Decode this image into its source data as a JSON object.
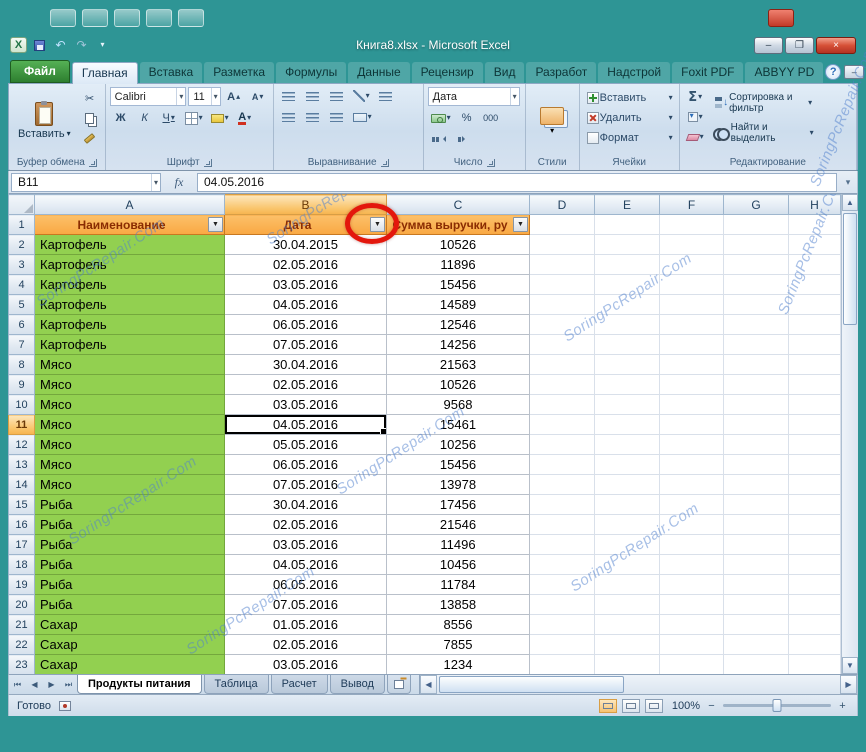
{
  "window": {
    "title": "Книга8.xlsx - Microsoft Excel"
  },
  "ribbon": {
    "tabs": [
      {
        "label": "Файл",
        "type": "file"
      },
      {
        "label": "Главная",
        "type": "active"
      },
      {
        "label": "Вставка",
        "type": "normal"
      },
      {
        "label": "Разметка",
        "type": "normal"
      },
      {
        "label": "Формулы",
        "type": "normal"
      },
      {
        "label": "Данные",
        "type": "normal"
      },
      {
        "label": "Рецензир",
        "type": "normal"
      },
      {
        "label": "Вид",
        "type": "normal"
      },
      {
        "label": "Разработ",
        "type": "normal"
      },
      {
        "label": "Надстрой",
        "type": "normal"
      },
      {
        "label": "Foxit PDF",
        "type": "normal"
      },
      {
        "label": "ABBYY PD",
        "type": "normal"
      }
    ],
    "clipboard": {
      "label": "Буфер обмена",
      "paste": "Вставить"
    },
    "font": {
      "label": "Шрифт",
      "name": "Calibri",
      "size": "11",
      "bold": "Ж",
      "italic": "К",
      "underline": "Ч"
    },
    "alignment": {
      "label": "Выравнивание"
    },
    "number": {
      "label": "Число",
      "format": "Дата",
      "percent": "%",
      "thousands": "000"
    },
    "styles": {
      "label": "Стили"
    },
    "cells": {
      "label": "Ячейки",
      "insert": "Вставить",
      "remove": "Удалить",
      "format": "Формат"
    },
    "editing": {
      "label": "Редактирование",
      "autosum": "Σ",
      "sort": "Сортировка и фильтр",
      "find": "Найти и выделить"
    }
  },
  "formula_bar": {
    "name_box": "B11",
    "fx": "fx",
    "value": "04.05.2016"
  },
  "grid": {
    "columns": [
      "A",
      "B",
      "C",
      "D",
      "E",
      "F",
      "G",
      "H"
    ],
    "selected_column": "B",
    "selected_row": 11,
    "header_row_number": "1",
    "headers": {
      "name": "Наименование",
      "date": "Дата",
      "sum": "Сумма выручки, ру"
    },
    "rows": [
      {
        "n": 2,
        "name": "Картофель",
        "date": "30.04.2015",
        "sum": "10526"
      },
      {
        "n": 3,
        "name": "Картофель",
        "date": "02.05.2016",
        "sum": "11896"
      },
      {
        "n": 4,
        "name": "Картофель",
        "date": "03.05.2016",
        "sum": "15456"
      },
      {
        "n": 5,
        "name": "Картофель",
        "date": "04.05.2016",
        "sum": "14589"
      },
      {
        "n": 6,
        "name": "Картофель",
        "date": "06.05.2016",
        "sum": "12546"
      },
      {
        "n": 7,
        "name": "Картофель",
        "date": "07.05.2016",
        "sum": "14256"
      },
      {
        "n": 8,
        "name": "Мясо",
        "date": "30.04.2016",
        "sum": "21563"
      },
      {
        "n": 9,
        "name": "Мясо",
        "date": "02.05.2016",
        "sum": "10526"
      },
      {
        "n": 10,
        "name": "Мясо",
        "date": "03.05.2016",
        "sum": "9568"
      },
      {
        "n": 11,
        "name": "Мясо",
        "date": "04.05.2016",
        "sum": "15461"
      },
      {
        "n": 12,
        "name": "Мясо",
        "date": "05.05.2016",
        "sum": "10256"
      },
      {
        "n": 13,
        "name": "Мясо",
        "date": "06.05.2016",
        "sum": "15456"
      },
      {
        "n": 14,
        "name": "Мясо",
        "date": "07.05.2016",
        "sum": "13978"
      },
      {
        "n": 15,
        "name": "Рыба",
        "date": "30.04.2016",
        "sum": "17456"
      },
      {
        "n": 16,
        "name": "Рыба",
        "date": "02.05.2016",
        "sum": "21546"
      },
      {
        "n": 17,
        "name": "Рыба",
        "date": "03.05.2016",
        "sum": "11496"
      },
      {
        "n": 18,
        "name": "Рыба",
        "date": "04.05.2016",
        "sum": "10456"
      },
      {
        "n": 19,
        "name": "Рыба",
        "date": "06.05.2016",
        "sum": "11784"
      },
      {
        "n": 20,
        "name": "Рыба",
        "date": "07.05.2016",
        "sum": "13858"
      },
      {
        "n": 21,
        "name": "Сахар",
        "date": "01.05.2016",
        "sum": "8556"
      },
      {
        "n": 22,
        "name": "Сахар",
        "date": "02.05.2016",
        "sum": "7855"
      },
      {
        "n": 23,
        "name": "Сахар",
        "date": "03.05.2016",
        "sum": "1234"
      }
    ]
  },
  "sheets": {
    "tabs": [
      {
        "label": "Продукты питания",
        "active": true
      },
      {
        "label": "Таблица",
        "active": false
      },
      {
        "label": "Расчет",
        "active": false
      },
      {
        "label": "Вывод",
        "active": false
      }
    ]
  },
  "status": {
    "mode": "Готово",
    "zoom": "100%"
  },
  "watermark": {
    "text": "SoringPcRepair.Com"
  }
}
